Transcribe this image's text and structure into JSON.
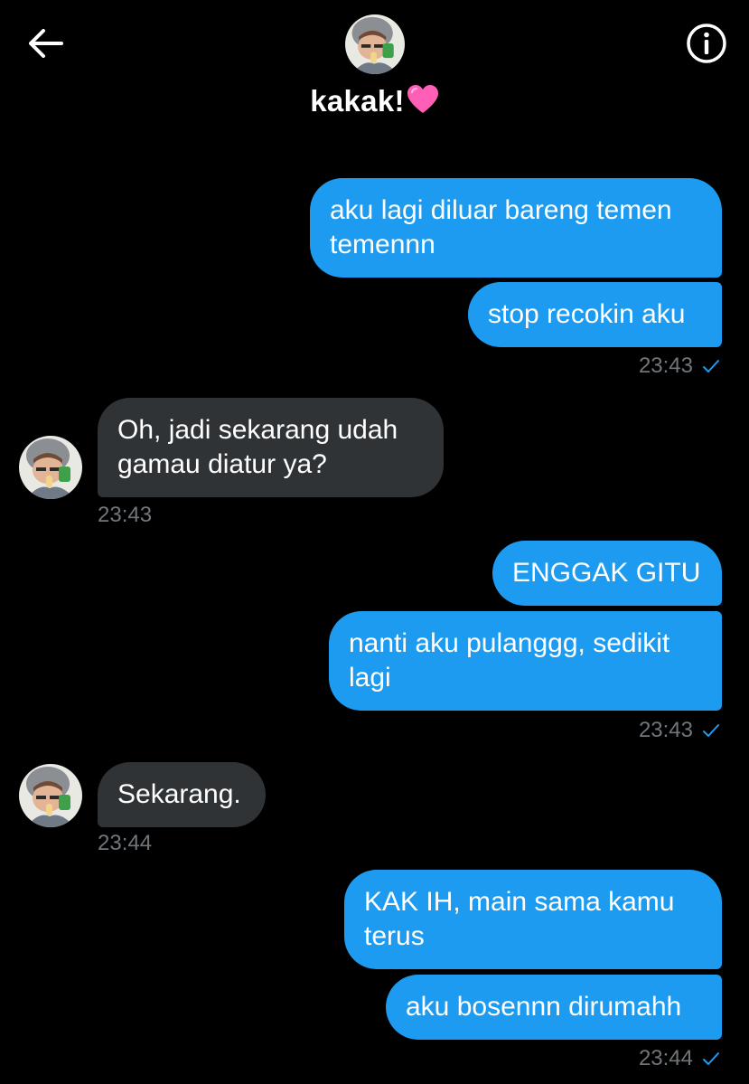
{
  "header": {
    "contact_name": "kakak!",
    "back_icon": "arrow-left-icon",
    "info_icon": "info-circle-icon",
    "accent_color": "#1d9bf0"
  },
  "messages": [
    {
      "dir": "out",
      "text": "aku lagi diluar bareng temen temennn"
    },
    {
      "dir": "out",
      "text": "stop recokin aku",
      "time": "23:43"
    },
    {
      "dir": "in",
      "text": "Oh, jadi sekarang udah gamau diatur ya?",
      "time": "23:43"
    },
    {
      "dir": "out",
      "text": "ENGGAK GITU"
    },
    {
      "dir": "out",
      "text": "nanti aku pulanggg, sedikit lagi",
      "time": "23:43"
    },
    {
      "dir": "in",
      "text": "Sekarang.",
      "time": "23:44"
    },
    {
      "dir": "out",
      "text": "KAK IH, main sama kamu terus"
    },
    {
      "dir": "out",
      "text": "aku bosennn dirumahh",
      "time": "23:44"
    }
  ]
}
